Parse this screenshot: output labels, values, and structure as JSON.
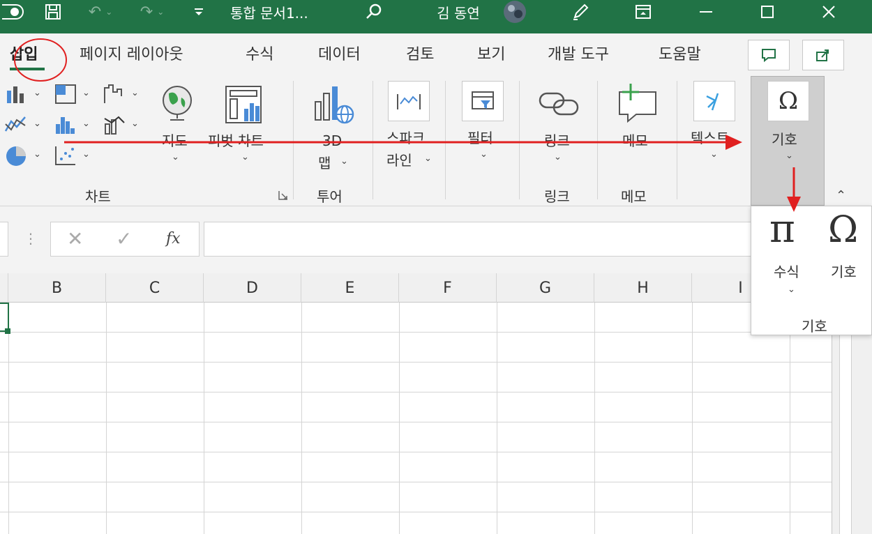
{
  "titlebar": {
    "title": "통합 문서1...",
    "user": "김 동연"
  },
  "tabs": [
    {
      "label": "삽입",
      "active": true
    },
    {
      "label": "페이지 레이아웃"
    },
    {
      "label": "수식"
    },
    {
      "label": "데이터"
    },
    {
      "label": "검토"
    },
    {
      "label": "보기"
    },
    {
      "label": "개발 도구"
    },
    {
      "label": "도움말"
    }
  ],
  "ribbon": {
    "charts": {
      "map_label": "지도",
      "pivot_label": "피벗 차트",
      "group_label": "차트"
    },
    "tour": {
      "map3d_line1": "3D",
      "map3d_line2": "맵",
      "group_label": "투어"
    },
    "sparkline": {
      "line1": "스파크",
      "line2": "라인"
    },
    "filter": {
      "label": "필터"
    },
    "links": {
      "label": "링크",
      "group_label": "링크"
    },
    "comments": {
      "label": "메모",
      "group_label": "메모"
    },
    "text": {
      "label": "텍스트"
    },
    "symbols": {
      "label": "기호"
    }
  },
  "formula_bar": {
    "fx": "fx"
  },
  "columns": [
    "B",
    "C",
    "D",
    "E",
    "F",
    "G",
    "H",
    "I"
  ],
  "dropdown": {
    "equation_label": "수식",
    "symbol_label": "기호",
    "group_label": "기호"
  },
  "colors": {
    "accent": "#217346",
    "annotation": "#e02020"
  }
}
